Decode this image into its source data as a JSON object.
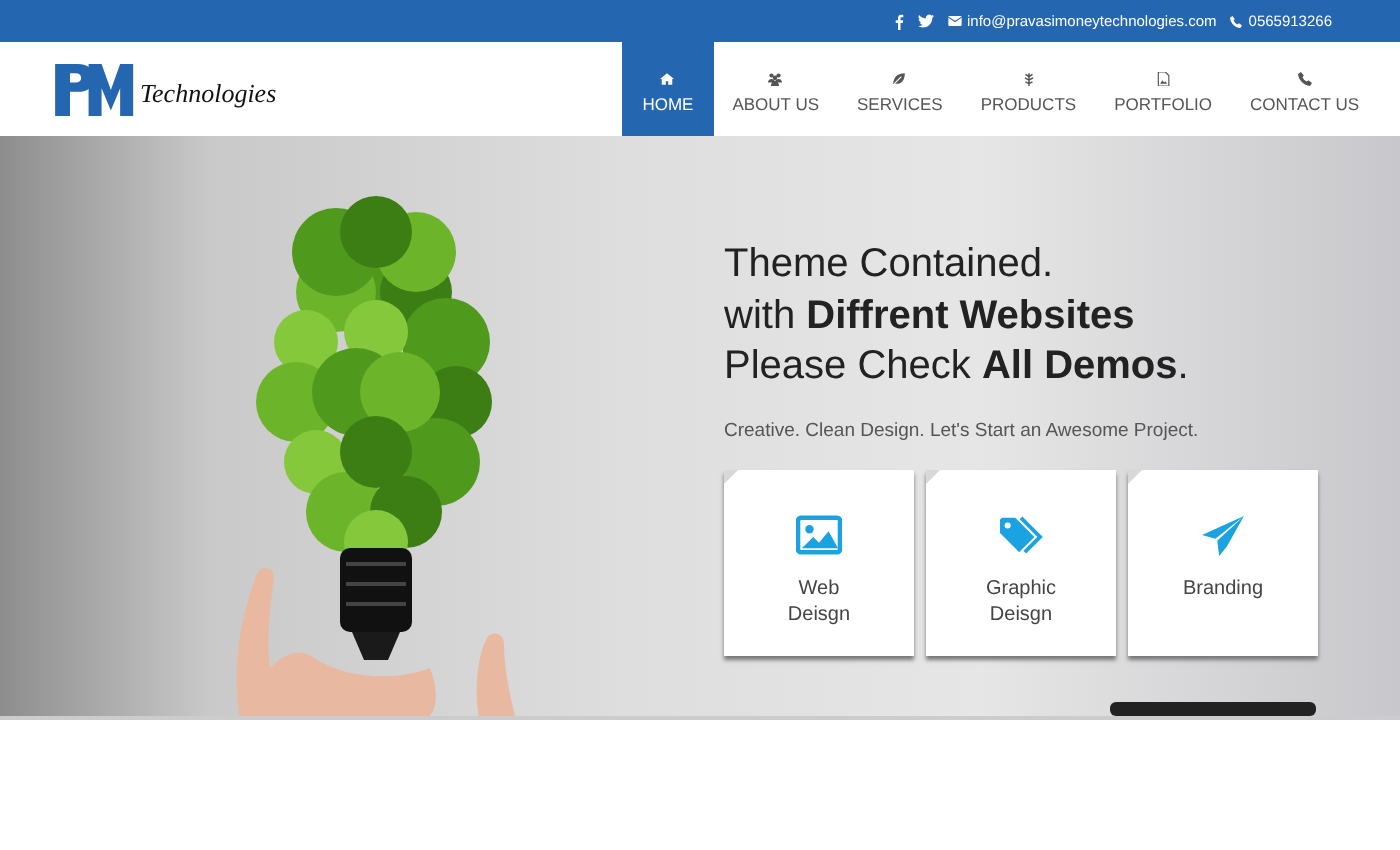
{
  "top_bar": {
    "email": "info@pravasimoneytechnologies.com",
    "phone": "0565913266"
  },
  "header": {
    "logo_text": "Technologies",
    "nav": [
      {
        "label": "HOME",
        "selected": true
      },
      {
        "label": "ABOUT US",
        "selected": false
      },
      {
        "label": "SERVICES",
        "selected": false
      },
      {
        "label": "PRODUCTS",
        "selected": false
      },
      {
        "label": "PORTFOLIO",
        "selected": false
      },
      {
        "label": "CONTACT US",
        "selected": false
      }
    ]
  },
  "hero": {
    "headline": [
      "Theme Contained.",
      "with **Diffrent Websites**",
      "Please Check **All Demos**."
    ],
    "subtitle": "Creative. Clean Design. Let's Start an Awesome Project.",
    "cards": [
      {
        "label": "Web\nDeisgn"
      },
      {
        "label": "Graphic\nDeisgn"
      },
      {
        "label": "Branding"
      }
    ]
  }
}
